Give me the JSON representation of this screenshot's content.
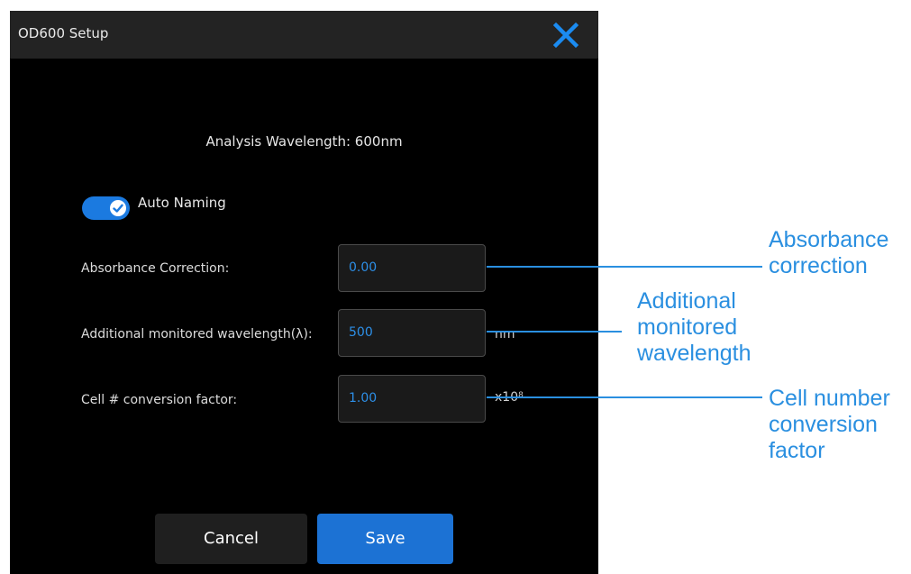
{
  "dialog": {
    "title": "OD600 Setup",
    "close_icon": "close-icon",
    "analysis_wavelength": "Analysis Wavelength: 600nm",
    "auto_naming": {
      "label": "Auto Naming",
      "enabled": true
    },
    "fields": [
      {
        "label": "Absorbance Correction:",
        "value": "0.00",
        "unit": ""
      },
      {
        "label": "Additional monitored wavelength(λ):",
        "value": "500",
        "unit": "nm"
      },
      {
        "label": "Cell # conversion factor:",
        "value": "1.00",
        "unit": "x10⁸"
      }
    ],
    "buttons": {
      "cancel": "Cancel",
      "save": "Save"
    }
  },
  "callouts": {
    "absorbance": [
      "Absorbance",
      "correction"
    ],
    "wavelength": [
      "Additional",
      "monitored",
      "wavelength"
    ],
    "conversion": [
      "Cell number",
      "conversion",
      "factor"
    ]
  },
  "colors": {
    "accent": "#1c72d4",
    "callout": "#2a8fe0",
    "background": "#000000",
    "titlebar": "#232323"
  }
}
